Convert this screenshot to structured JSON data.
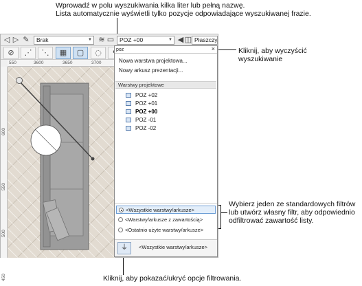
{
  "callouts": {
    "top_line1": "Wprowadź w polu wyszukiwania kilka liter lub pełną nazwę.",
    "top_line2": "Lista automatycznie wyświetli tylko pozycje odpowiadające wyszukiwanej frazie.",
    "clear_line1": "Kliknij, aby wyczyścić",
    "clear_line2": "wyszukiwanie",
    "filters_line1": "Wybierz jeden ze standardowych filtrów",
    "filters_line2": "lub utwórz własny filtr, aby odpowiednio",
    "filters_line3": "odfiltrować zawartość listy.",
    "bottom": "Kliknij, aby pokazać/ukryć opcje filtrowania."
  },
  "toolbar": {
    "class_combo": "Brak",
    "layer_combo": "POZ +00",
    "view_combo": "Płaszczyzna"
  },
  "rulers": {
    "h": [
      "550",
      "3600",
      "3650",
      "3700"
    ],
    "v": [
      "600",
      "550",
      "500",
      "450"
    ]
  },
  "panel": {
    "search_value": "poz",
    "clear_icon": "×",
    "menu": [
      "Nowa warstwa projektowa...",
      "Nowy arkusz prezentacji..."
    ],
    "section_header": "Warstwy projektowe",
    "layers": [
      {
        "label": "POZ +02",
        "active": false
      },
      {
        "label": "POZ +01",
        "active": false
      },
      {
        "label": "POZ +00",
        "active": true
      },
      {
        "label": "POZ -01",
        "active": false
      },
      {
        "label": "POZ -02",
        "active": false
      }
    ],
    "filters": [
      {
        "label": "<Wszystkie warstwy/arkusze>",
        "checked": true
      },
      {
        "label": "<Warstwy/arkusze z zawartością>",
        "checked": false
      },
      {
        "label": "<Ostatnio użyte warstwy/arkusze>",
        "checked": false
      }
    ],
    "bottom_label": "<Wszystkie warstwy/arkusze>"
  },
  "colors": {
    "selection": "#6d9ed6",
    "sofa": "#9c9c9c",
    "floor": "#e2dbd1"
  }
}
